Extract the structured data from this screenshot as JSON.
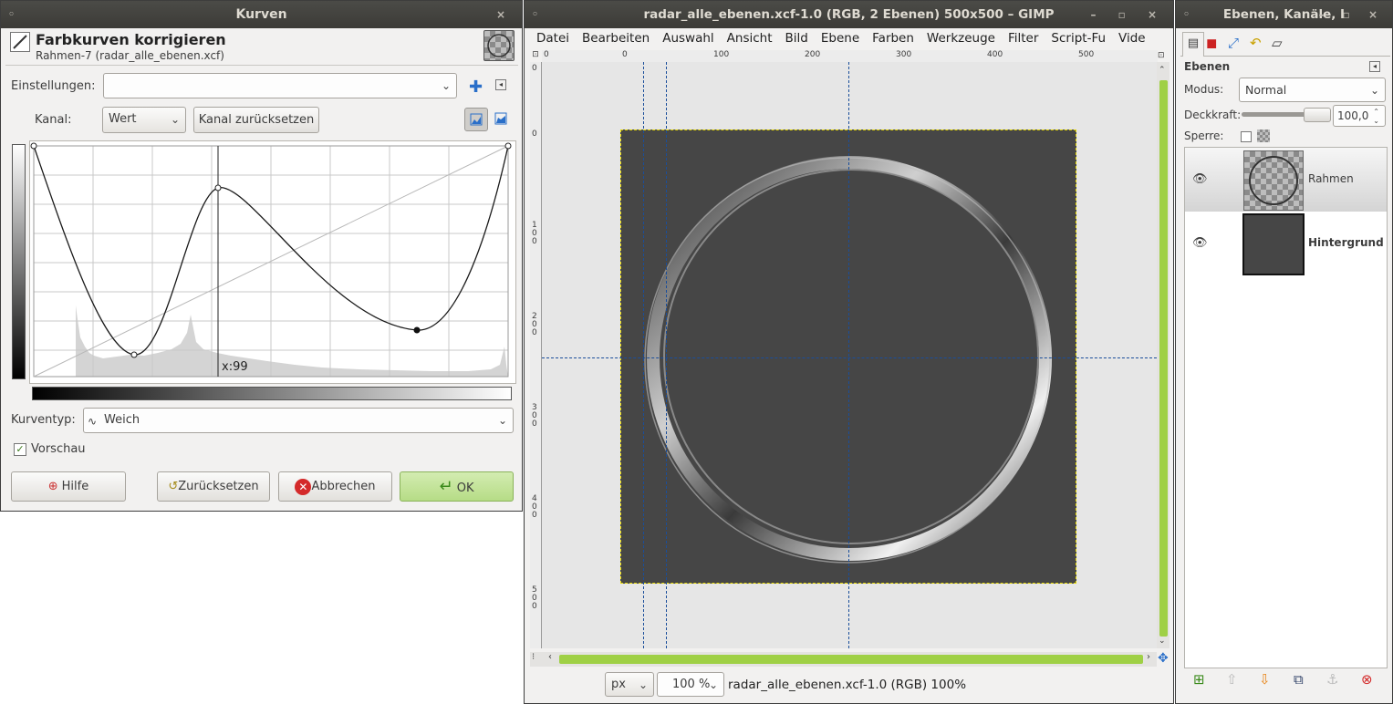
{
  "curves_dialog": {
    "window_title": "Kurven",
    "heading": "Farbkurven korrigieren",
    "subheading": "Rahmen-7 (radar_alle_ebenen.xcf)",
    "settings_label": "Einstellungen:",
    "settings_value": "",
    "channel_label": "Kanal:",
    "channel_value": "Wert",
    "reset_channel_label": "Kanal zurücksetzen",
    "cursor_readout": "x:99",
    "curve_type_label": "Kurventyp:",
    "curve_type_value": "Weich",
    "preview_label": "Vorschau",
    "preview_checked": true,
    "help_label": "Hilfe",
    "reset_label": "Zurücksetzen",
    "cancel_label": "Abbrechen",
    "ok_label": "OK"
  },
  "image_window": {
    "title": "radar_alle_ebenen.xcf-1.0 (RGB, 2 Ebenen) 500x500 – GIMP",
    "menu": [
      "Datei",
      "Bearbeiten",
      "Auswahl",
      "Ansicht",
      "Bild",
      "Ebene",
      "Farben",
      "Werkzeuge",
      "Filter",
      "Script-Fu",
      "Vide"
    ],
    "ruler_h": [
      "0",
      "0",
      "100",
      "200",
      "300",
      "400",
      "500"
    ],
    "ruler_v": [
      "0",
      "0",
      "1\n0\n0",
      "2\n0\n0",
      "3\n0\n0",
      "4\n0\n0",
      "5\n0\n0"
    ],
    "unit": "px",
    "zoom": "100 %",
    "status": "radar_alle_ebenen.xcf-1.0 (RGB) 100%"
  },
  "layers_window": {
    "title": "Ebenen, Kanäle, I",
    "panel_title": "Ebenen",
    "mode_label": "Modus:",
    "mode_value": "Normal",
    "opacity_label": "Deckkraft:",
    "opacity_value": "100,0",
    "opacity_fraction": 1.0,
    "lock_label": "Sperre:",
    "layers": [
      {
        "name": "Rahmen",
        "selected": true,
        "visible": true
      },
      {
        "name": "Hintergrund",
        "selected": false,
        "visible": true
      }
    ]
  },
  "colors": {
    "accent_green": "#9fd045",
    "canvas_gray": "#464646",
    "titlebar": "#3c3b37"
  }
}
